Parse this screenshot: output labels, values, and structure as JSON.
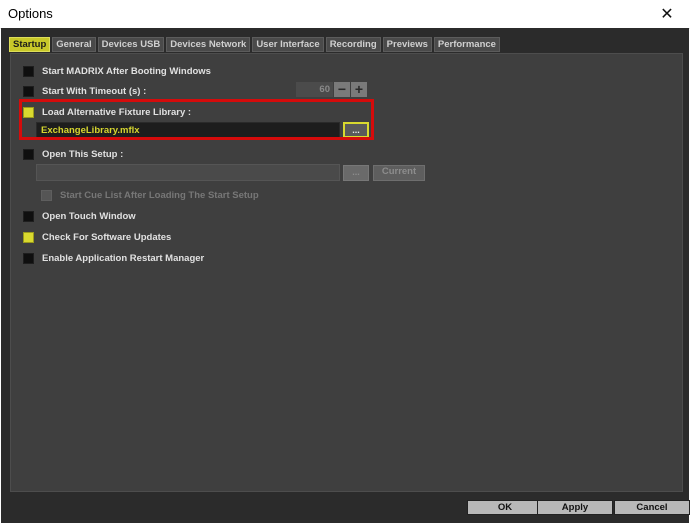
{
  "window": {
    "title": "Options",
    "close_glyph": "✕"
  },
  "tabs": [
    {
      "label": "Startup",
      "active": true
    },
    {
      "label": "General",
      "active": false
    },
    {
      "label": "Devices USB",
      "active": false
    },
    {
      "label": "Devices Network",
      "active": false
    },
    {
      "label": "User Interface",
      "active": false
    },
    {
      "label": "Recording",
      "active": false
    },
    {
      "label": "Previews",
      "active": false
    },
    {
      "label": "Performance",
      "active": false
    }
  ],
  "startup": {
    "start_madrix_after_boot": {
      "label": "Start MADRIX After Booting Windows",
      "checked": false
    },
    "start_with_timeout": {
      "label": "Start With Timeout (s) :",
      "checked": false,
      "value": "60",
      "minus": "−",
      "plus": "+"
    },
    "load_alt_fixture_library": {
      "label": "Load Alternative Fixture Library :",
      "checked": true,
      "path": "ExchangeLibrary.mflx",
      "browse_label": "..."
    },
    "open_this_setup": {
      "label": "Open This Setup :",
      "checked": false,
      "path": "",
      "browse_label": "...",
      "current_label": "Current"
    },
    "start_cue_list": {
      "label": "Start Cue List After Loading The Start Setup",
      "checked": false,
      "disabled": true
    },
    "open_touch_window": {
      "label": "Open Touch Window",
      "checked": false
    },
    "check_updates": {
      "label": "Check For Software Updates",
      "checked": true
    },
    "restart_manager": {
      "label": "Enable Application Restart Manager",
      "checked": false
    }
  },
  "footer": {
    "ok_label": "OK",
    "apply_label": "Apply",
    "cancel_label": "Cancel"
  },
  "colors": {
    "accent": "#d9d92f",
    "highlight_border": "#d50b0b",
    "panel_bg": "#3f3f3f",
    "frame_bg": "#2b2b2b"
  }
}
